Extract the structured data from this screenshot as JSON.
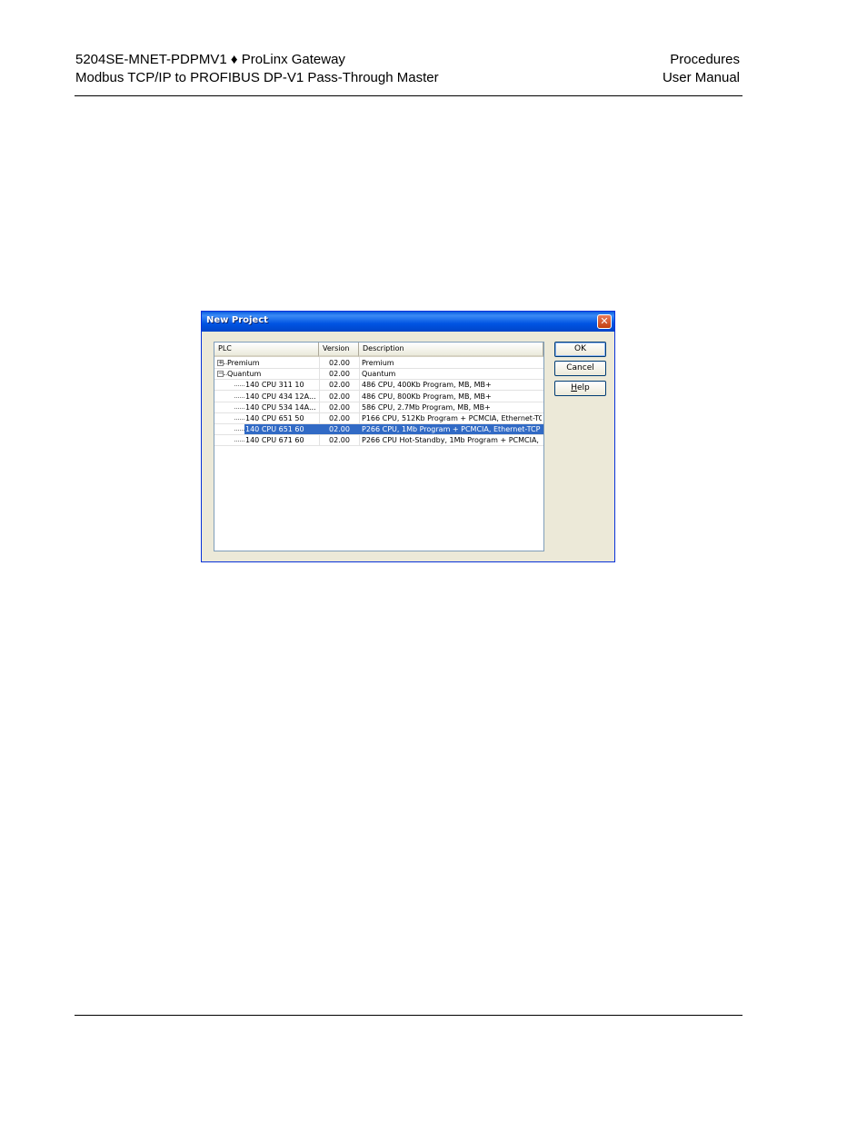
{
  "header": {
    "left_line1": "5204SE-MNET-PDPMV1 ♦ ProLinx Gateway",
    "left_line2": "Modbus TCP/IP to PROFIBUS DP-V1 Pass-Through Master",
    "right_line1": "Procedures",
    "right_line2": "User Manual"
  },
  "dialog": {
    "title": "New Project",
    "close_glyph": "✕",
    "columns": [
      "PLC",
      "Version",
      "Description"
    ],
    "rows": [
      {
        "plc": "Premium",
        "version": "02.00",
        "description": "Premium",
        "level": 0,
        "expander": "+"
      },
      {
        "plc": "Quantum",
        "version": "02.00",
        "description": "Quantum",
        "level": 0,
        "expander": "−"
      },
      {
        "plc": "140 CPU 311 10",
        "version": "02.00",
        "description": "486 CPU, 400Kb Program, MB, MB+",
        "level": 1
      },
      {
        "plc": "140 CPU 434 12A...",
        "version": "02.00",
        "description": "486 CPU, 800Kb Program, MB, MB+",
        "level": 1
      },
      {
        "plc": "140 CPU 534 14A...",
        "version": "02.00",
        "description": "586 CPU, 2.7Mb Program, MB, MB+",
        "level": 1
      },
      {
        "plc": "140 CPU 651 50",
        "version": "02.00",
        "description": "P166 CPU, 512Kb Program + PCMCIA, Ethernet-TC...",
        "level": 1
      },
      {
        "plc": "140 CPU 651 60",
        "version": "02.00",
        "description": "P266 CPU, 1Mb Program + PCMCIA, Ethernet-TCP ...",
        "level": 1,
        "selected": true
      },
      {
        "plc": "140 CPU 671 60",
        "version": "02.00",
        "description": "P266 CPU Hot-Standby, 1Mb Program + PCMCIA, ...",
        "level": 1
      }
    ],
    "buttons": {
      "ok": "OK",
      "cancel": "Cancel",
      "help_first": "H",
      "help_rest": "elp"
    },
    "selection_color": "#316ac5"
  }
}
